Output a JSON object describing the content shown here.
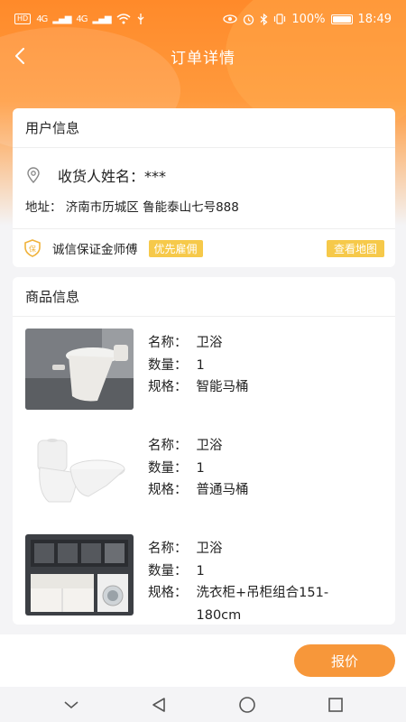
{
  "status_bar": {
    "hd_badge": "HD",
    "network_1": "4G",
    "network_2": "4G",
    "battery_percent": "100%",
    "time": "18:49"
  },
  "nav": {
    "title": "订单详情"
  },
  "user_info": {
    "section_title": "用户信息",
    "consignee": "收货人姓名：***",
    "address": "地址：  济南市历城区 鲁能泰山七号888",
    "trust_label": "诚信保证金师傅",
    "priority_tag": "优先雇佣",
    "map_button": "查看地图"
  },
  "goods_info": {
    "section_title": "商品信息",
    "labels": {
      "name": "名称：",
      "qty": "数量：",
      "spec": "规格："
    },
    "items": [
      {
        "name": "卫浴",
        "qty": "1",
        "spec": "智能马桶",
        "image": "smart-toilet"
      },
      {
        "name": "卫浴",
        "qty": "1",
        "spec": "普通马桶",
        "image": "standard-toilet"
      },
      {
        "name": "卫浴",
        "qty": "1",
        "spec": "洗衣柜+吊柜组合151-180cm",
        "image": "laundry-cabinet"
      }
    ]
  },
  "footer": {
    "quote_button": "报价"
  },
  "icons": {
    "back": "chevron-left-icon",
    "location": "location-pin-icon",
    "trust": "shield-icon"
  },
  "colors": {
    "accent": "#f7973a",
    "header_orange": "#ff8a2a",
    "tag_yellow": "#f6c94a"
  }
}
